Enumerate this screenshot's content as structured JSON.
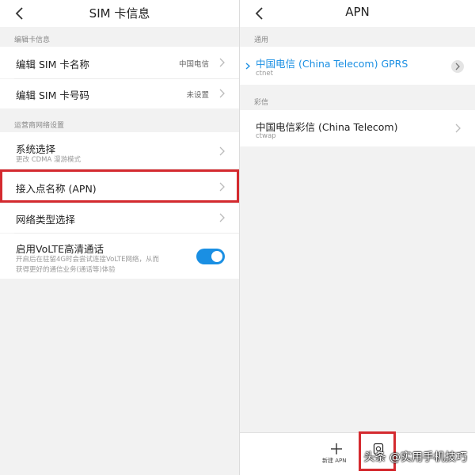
{
  "left": {
    "title": "SIM  卡信息",
    "section1": "编辑卡信息",
    "rows1": [
      {
        "label": "编辑 SIM 卡名称",
        "value": "中国电信"
      },
      {
        "label": "编辑 SIM 卡号码",
        "value": "未设置"
      }
    ],
    "section2": "运营商网络设置",
    "system_select": {
      "label": "系统选择",
      "sub": "更改 CDMA 漫游模式"
    },
    "apn": {
      "label": "接入点名称 (APN)"
    },
    "network_type": {
      "label": "网络类型选择"
    },
    "volte": {
      "label": "启用VoLTE高清通话",
      "sub1": "开启后在驻留4G时会尝试连接VoLTE网络，从而",
      "sub2": "获得更好的通信业务(通话等)体验",
      "enabled": true
    }
  },
  "right": {
    "title": "APN",
    "section_general": "通用",
    "apn_general": {
      "name": "中国电信 (China Telecom) GPRS",
      "apn": "ctnet",
      "selected": true
    },
    "section_mms": "彩信",
    "apn_mms": {
      "name": "中国电信彩信 (China Telecom)",
      "apn": "ctwap"
    },
    "bottom": {
      "new_apn": "新建 APN"
    }
  },
  "watermark": "头条 @实用手机技巧",
  "colors": {
    "accent": "#1a8fe3",
    "highlight": "#d42a2f",
    "background": "#f2f2f2"
  },
  "icons": [
    "back-arrow-icon",
    "chevron-right-icon",
    "plus-icon",
    "reset-icon"
  ]
}
